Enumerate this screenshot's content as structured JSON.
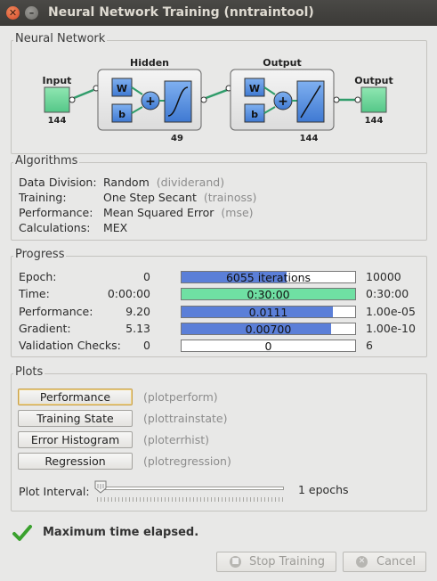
{
  "window": {
    "title": "Neural Network Training (nntraintool)"
  },
  "network": {
    "section_title": "Neural Network",
    "input_label": "Input",
    "input_size": "144",
    "hidden_label": "Hidden",
    "hidden_size": "49",
    "output_layer_label": "Output",
    "output_layer_size": "144",
    "output_label": "Output",
    "output_size": "144",
    "weight_symbol": "W",
    "bias_symbol": "b",
    "sum_symbol": "+"
  },
  "algorithms": {
    "section_title": "Algorithms",
    "rows": [
      {
        "label": "Data Division:",
        "value": "Random",
        "fn": "(dividerand)"
      },
      {
        "label": "Training:",
        "value": "One Step Secant",
        "fn": "(trainoss)"
      },
      {
        "label": "Performance:",
        "value": "Mean Squared Error",
        "fn": "(mse)"
      },
      {
        "label": "Calculations:",
        "value": "MEX",
        "fn": ""
      }
    ]
  },
  "progress": {
    "section_title": "Progress",
    "rows": [
      {
        "label": "Epoch:",
        "min": "0",
        "current": "6055 iterations",
        "max": "10000",
        "fill_fraction": 0.6055,
        "fill_color": "#5b7fd8"
      },
      {
        "label": "Time:",
        "min": "0:00:00",
        "current": "0:30:00",
        "max": "0:30:00",
        "fill_fraction": 1.0,
        "fill_color": "#6fe0a3"
      },
      {
        "label": "Performance:",
        "min": "9.20",
        "current": "0.0111",
        "max": "1.00e-05",
        "fill_fraction": 0.87,
        "fill_color": "#5b7fd8"
      },
      {
        "label": "Gradient:",
        "min": "5.13",
        "current": "0.00700",
        "max": "1.00e-10",
        "fill_fraction": 0.86,
        "fill_color": "#5b7fd8"
      },
      {
        "label": "Validation Checks:",
        "min": "0",
        "current": "0",
        "max": "6",
        "fill_fraction": 0,
        "fill_color": "#5b7fd8"
      }
    ]
  },
  "plots": {
    "section_title": "Plots",
    "buttons": [
      {
        "label": "Performance",
        "fn": "(plotperform)"
      },
      {
        "label": "Training State",
        "fn": "(plottrainstate)"
      },
      {
        "label": "Error Histogram",
        "fn": "(ploterrhist)"
      },
      {
        "label": "Regression",
        "fn": "(plotregression)"
      }
    ],
    "interval_label": "Plot Interval:",
    "interval_value": "1 epochs",
    "interval_fraction": 0
  },
  "status": {
    "message": "Maximum time elapsed.",
    "icon": "checkmark-icon",
    "color": "#3aa12e"
  },
  "footer": {
    "stop_label": "Stop Training",
    "cancel_label": "Cancel",
    "stop_icon": "stop-icon",
    "cancel_icon": "cancel-icon"
  }
}
